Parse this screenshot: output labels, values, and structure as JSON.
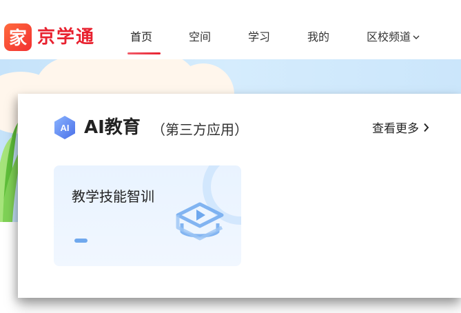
{
  "brand": {
    "logo_glyph": "家",
    "name": "京学通",
    "color": "#e8212f"
  },
  "nav": {
    "items": [
      "首页",
      "空间",
      "学习",
      "我的",
      "区校频道"
    ],
    "active_index": 0,
    "dropdown_item_index": 4
  },
  "section": {
    "badge": "AI",
    "title": "AI教育",
    "subtitle": "（第三方应用）",
    "more_label": "查看更多"
  },
  "apps": [
    {
      "name": "教学技能智训",
      "icon": "graduation-cap-play-icon"
    }
  ],
  "colors": {
    "accent_red": "#e8212f",
    "banner_blue": "#d5ecfd",
    "tile_bg": "#e9f3ff",
    "icon_blue": "#6fa8ee"
  }
}
